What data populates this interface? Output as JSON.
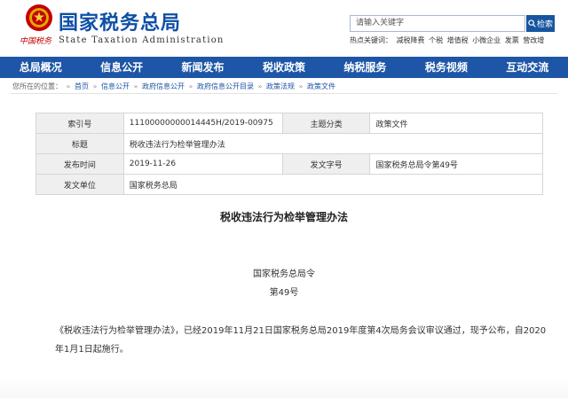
{
  "header": {
    "cn_text": "中国税务",
    "site_name_cn": "国家税务总局",
    "site_name_en": "State Taxation Administration"
  },
  "search": {
    "placeholder": "请输入关键字",
    "button_label": "检索",
    "hotwords_label": "热点关键词：",
    "hotwords": [
      "减税降费",
      "个税",
      "增值税",
      "小微企业",
      "发票",
      "营改增"
    ]
  },
  "nav": {
    "items": [
      "总局概况",
      "信息公开",
      "新闻发布",
      "税收政策",
      "纳税服务",
      "税务视频",
      "互动交流"
    ]
  },
  "breadcrumb": {
    "prefix": "您所在的位置：",
    "items": [
      "首页",
      "信息公开",
      "政府信息公开",
      "政府信息公开目录",
      "政策法规",
      "政策文件"
    ]
  },
  "info": {
    "rows": [
      {
        "l1": "索引号",
        "v1": "11100000000014445H/2019-00975",
        "l2": "主题分类",
        "v2": "政策文件"
      },
      {
        "l1": "标题",
        "v1": "税收违法行为检举管理办法"
      },
      {
        "l1": "发布时间",
        "v1": "2019-11-26",
        "l2": "发文字号",
        "v2": "国家税务总局令第49号"
      },
      {
        "l1": "发文单位",
        "v1": "国家税务总局"
      }
    ]
  },
  "article": {
    "title": "税收违法行为检举管理办法",
    "issuer": "国家税务总局令",
    "number": "第49号",
    "body": "《税收违法行为检举管理办法》，已经2019年11月21日国家税务总局2019年度第4次局务会议审议通过，现予公布，自2020年1月1日起施行。"
  },
  "colors": {
    "brand_blue": "#1d56a6",
    "title_blue": "#0e4fa6",
    "emblem_red": "#c40000",
    "label_bg": "#efefef"
  },
  "icons": [
    "national-emblem-icon",
    "search-icon"
  ]
}
